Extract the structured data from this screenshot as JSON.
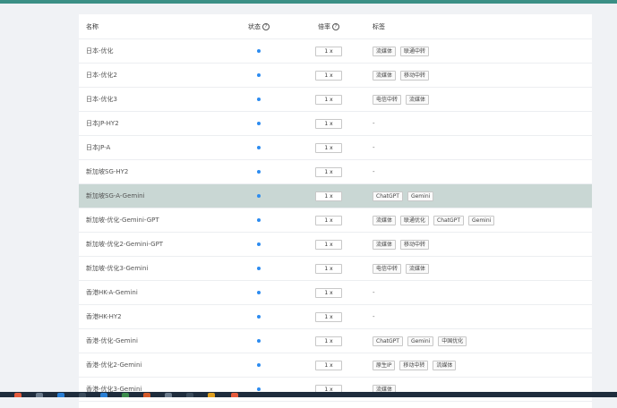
{
  "table": {
    "headers": {
      "name": "名称",
      "status": "状态",
      "rate": "倍率",
      "tags": "标签"
    },
    "status_help_icon": "question-circle-icon",
    "rate_help_icon": "question-circle-icon",
    "rows": [
      {
        "name": "日本-优化",
        "rate": "1 x",
        "tags": [
          "流媒体",
          "联通中转"
        ],
        "highlight": false
      },
      {
        "name": "日本-优化2",
        "rate": "1 x",
        "tags": [
          "流媒体",
          "移动中转"
        ],
        "highlight": false
      },
      {
        "name": "日本-优化3",
        "rate": "1 x",
        "tags": [
          "电信中转",
          "流媒体"
        ],
        "highlight": false
      },
      {
        "name": "日本JP-HY2",
        "rate": "1 x",
        "tags": [],
        "highlight": false
      },
      {
        "name": "日本JP-A",
        "rate": "1 x",
        "tags": [],
        "highlight": false
      },
      {
        "name": "新加坡SG-HY2",
        "rate": "1 x",
        "tags": [],
        "highlight": false
      },
      {
        "name": "新加坡SG-A-Gemini",
        "rate": "1 x",
        "tags": [
          "ChatGPT",
          "Gemini"
        ],
        "highlight": true
      },
      {
        "name": "新加坡-优化-Gemini-GPT",
        "rate": "1 x",
        "tags": [
          "流媒体",
          "联通优化",
          "ChatGPT",
          "Gemini"
        ],
        "highlight": false
      },
      {
        "name": "新加坡-优化2-Gemini-GPT",
        "rate": "1 x",
        "tags": [
          "流媒体",
          "移动中转"
        ],
        "highlight": false
      },
      {
        "name": "新加坡-优化3-Gemini",
        "rate": "1 x",
        "tags": [
          "电信中转",
          "流媒体"
        ],
        "highlight": false
      },
      {
        "name": "香港HK-A-Gemini",
        "rate": "1 x",
        "tags": [],
        "highlight": false
      },
      {
        "name": "香港HK-HY2",
        "rate": "1 x",
        "tags": [],
        "highlight": false
      },
      {
        "name": "香港-优化-Gemini",
        "rate": "1 x",
        "tags": [
          "ChatGPT",
          "Gemini",
          "中国优化"
        ],
        "highlight": false
      },
      {
        "name": "香港-优化2-Gemini",
        "rate": "1 x",
        "tags": [
          "原生IP",
          "移动中转",
          "流媒体"
        ],
        "highlight": false
      },
      {
        "name": "香港-优化3-Gemini",
        "rate": "1 x",
        "tags": [
          "流媒体"
        ],
        "highlight": false
      }
    ],
    "empty_tags_text": "-"
  },
  "colors": {
    "accent": "#3b8f85",
    "status_dot": "#2d8cf0",
    "highlight_row": "#c9d7d4"
  }
}
